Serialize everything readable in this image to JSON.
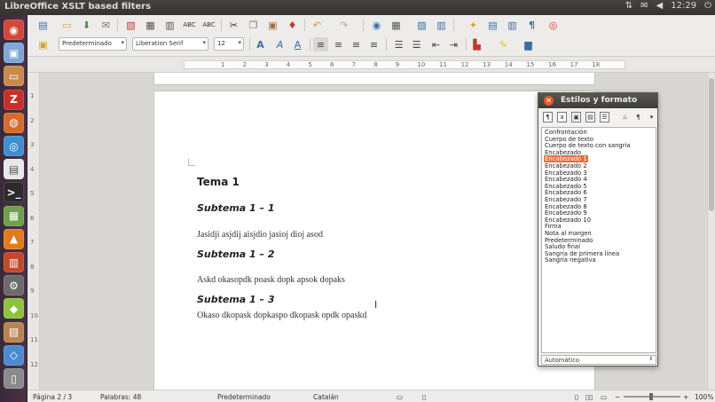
{
  "window": {
    "title": "LibreOffice XSLT based filters"
  },
  "tray": {
    "time": "12:29",
    "icons": [
      "network-icon",
      "mail-icon",
      "sound-icon",
      "power-icon"
    ]
  },
  "launcher": [
    {
      "name": "dash-icon",
      "color": "#d2473a",
      "glyph": "◉"
    },
    {
      "name": "software-center-icon",
      "color": "#7ca7d6",
      "glyph": "▣"
    },
    {
      "name": "files-icon",
      "color": "#c98a4b",
      "glyph": "▭"
    },
    {
      "name": "filezilla-icon",
      "color": "#c53129",
      "glyph": "Z"
    },
    {
      "name": "firefox-icon",
      "color": "#d86a2a",
      "glyph": "◍"
    },
    {
      "name": "chromium-icon",
      "color": "#3e8ed0",
      "glyph": "◎"
    },
    {
      "name": "writer-doc-icon",
      "color": "#e8e8e8",
      "glyph": "▤"
    },
    {
      "name": "terminal-icon",
      "color": "#2b2b2b",
      "glyph": ">_"
    },
    {
      "name": "image-viewer-icon",
      "color": "#6ea04a",
      "glyph": "▦"
    },
    {
      "name": "vlc-icon",
      "color": "#e27b1d",
      "glyph": "▲"
    },
    {
      "name": "impress-icon",
      "color": "#c0482b",
      "glyph": "▥"
    },
    {
      "name": "settings-icon",
      "color": "#6b6b6b",
      "glyph": "⚙"
    },
    {
      "name": "android-icon",
      "color": "#8dc33c",
      "glyph": "◆"
    },
    {
      "name": "archive-icon",
      "color": "#b88452",
      "glyph": "▧"
    },
    {
      "name": "libreoffice-icon",
      "color": "#4a8bd1",
      "glyph": "◇"
    },
    {
      "name": "trash-icon",
      "color": "#8a8a8a",
      "glyph": "▯"
    }
  ],
  "toolbar": {
    "paragraph_style": "Predeterminado",
    "font_name": "Liberation Serif",
    "font_size": "12"
  },
  "ruler": {
    "numbers": [
      "1",
      "2",
      "3",
      "4",
      "5",
      "6",
      "7",
      "8",
      "9",
      "10",
      "11",
      "12",
      "13",
      "14",
      "15",
      "16",
      "17",
      "18"
    ]
  },
  "vruler": {
    "numbers": [
      "1",
      "2",
      "3",
      "4",
      "5",
      "6",
      "7",
      "8",
      "9",
      "10",
      "11",
      "12"
    ]
  },
  "document": {
    "h1": "Tema 1",
    "h2a": "Subtema 1 – 1",
    "p1": "Jasidji asjdij aisjdio jasioj dioj asod",
    "h2b": "Subtema 1 – 2",
    "p2": "Askd okasopdk poask dopk apsok dopaks",
    "h2c": "Subtema 1 – 3",
    "p3": "Okaso dkopask dopkaspo dkopask opdk opaskd"
  },
  "styles_panel": {
    "title": "Estilos y formato",
    "items": [
      "Confrontación",
      "Cuerpo de texto",
      "Cuerpo de texto con sangría",
      "Encabezado",
      "Encabezado 1",
      "Encabezado 2",
      "Encabezado 3",
      "Encabezado 4",
      "Encabezado 5",
      "Encabezado 6",
      "Encabezado 7",
      "Encabezado 8",
      "Encabezado 9",
      "Encabezado 10",
      "Firma",
      "Nota al margen",
      "Predeterminado",
      "Saludo final",
      "Sangría de primera línea",
      "Sangría negativa"
    ],
    "selected_index": 4,
    "filter": "Automático"
  },
  "status": {
    "page": "Página  2 / 3",
    "words": "Palabras: 48",
    "style": "Predeterminado",
    "language": "Catalán",
    "zoom": "100%"
  }
}
